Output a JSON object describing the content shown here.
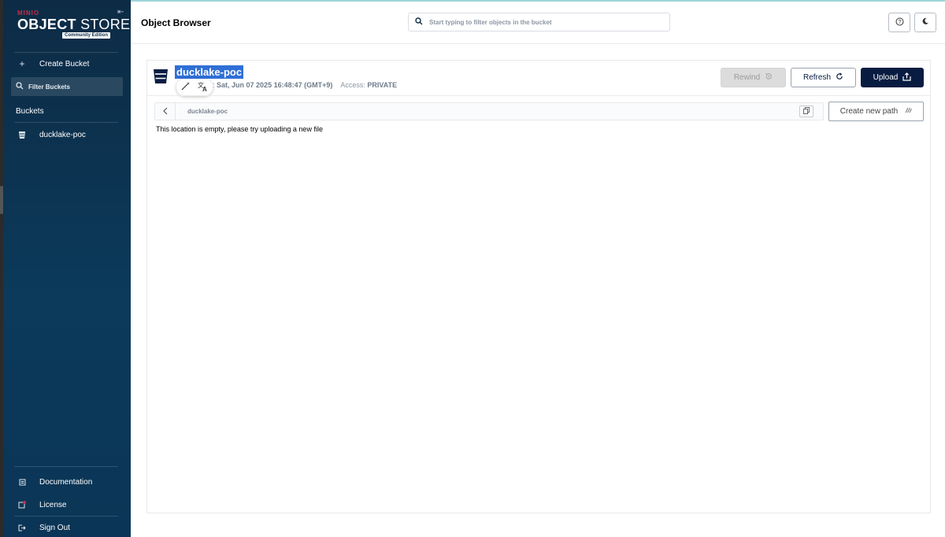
{
  "sidebar": {
    "logo": {
      "brand": "MINIO",
      "product_bold": "OBJECT",
      "product_light": " STORE",
      "edition": "Community Edition"
    },
    "create_bucket": "Create Bucket",
    "filter_placeholder": "Filter Buckets",
    "buckets_title": "Buckets",
    "buckets": [
      {
        "name": "ducklake-poc"
      }
    ],
    "footer": [
      {
        "label": "Documentation",
        "icon": "document-icon"
      },
      {
        "label": "License",
        "icon": "license-icon"
      },
      {
        "label": "Sign Out",
        "icon": "sign-out-icon"
      }
    ]
  },
  "header": {
    "title": "Object Browser",
    "search_placeholder": "Start typing to filter objects in the bucket"
  },
  "bucket": {
    "name": "ducklake-poc",
    "created_label": ":",
    "created_value": "Sat, Jun 07 2025 16:48:47 (GMT+9)",
    "access_label": "Access:",
    "access_value": "PRIVATE"
  },
  "toolbar": {
    "rewind": "Rewind",
    "refresh": "Refresh",
    "upload": "Upload"
  },
  "browser": {
    "path": "ducklake-poc",
    "create_path": "Create new path",
    "empty_message": "This location is empty, please try uploading a new file"
  },
  "colors": {
    "sidebar_bg": "#0d2b45",
    "brand_red": "#c72c48",
    "upload_bg": "#081c42",
    "selection_blue": "#2f6fd6"
  }
}
